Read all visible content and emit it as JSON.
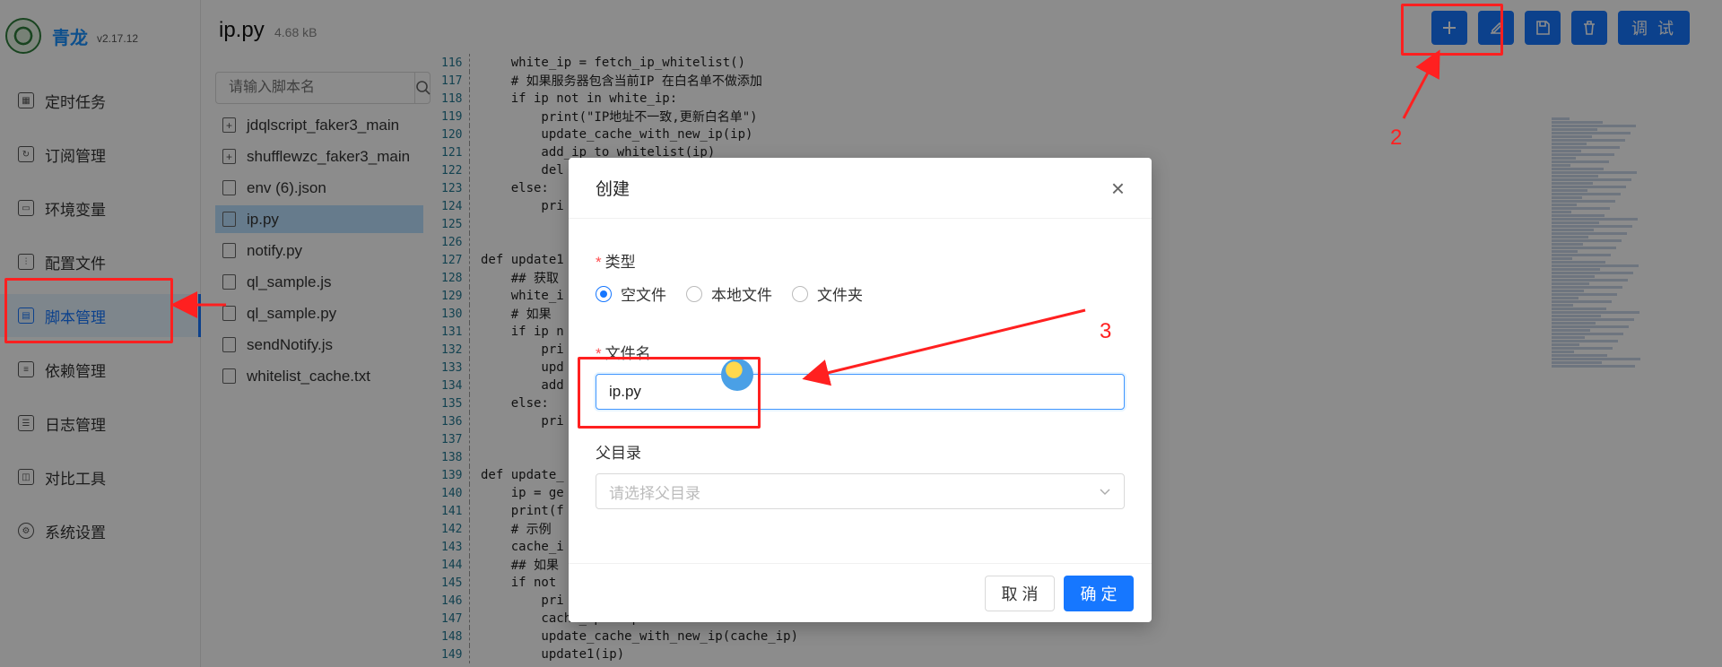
{
  "app": {
    "name": "青龙",
    "version": "v2.17.12"
  },
  "sidebar": {
    "items": [
      {
        "label": "定时任务",
        "icon": "calendar-icon"
      },
      {
        "label": "订阅管理",
        "icon": "subscribe-icon"
      },
      {
        "label": "环境变量",
        "icon": "monitor-icon"
      },
      {
        "label": "配置文件",
        "icon": "sliders-icon"
      },
      {
        "label": "脚本管理",
        "icon": "script-icon",
        "active": true
      },
      {
        "label": "依赖管理",
        "icon": "dependency-icon"
      },
      {
        "label": "日志管理",
        "icon": "log-icon"
      },
      {
        "label": "对比工具",
        "icon": "diff-icon"
      },
      {
        "label": "系统设置",
        "icon": "gear-icon"
      }
    ]
  },
  "header": {
    "file_name": "ip.py",
    "file_size": "4.68 kB",
    "debug_label": "调 试"
  },
  "file_panel": {
    "search_placeholder": "请输入脚本名",
    "files": [
      {
        "name": "jdqlscript_faker3_main",
        "type": "folder"
      },
      {
        "name": "shufflewzc_faker3_main",
        "type": "folder"
      },
      {
        "name": "env (6).json",
        "type": "file"
      },
      {
        "name": "ip.py",
        "type": "file",
        "selected": true
      },
      {
        "name": "notify.py",
        "type": "file"
      },
      {
        "name": "ql_sample.js",
        "type": "file"
      },
      {
        "name": "ql_sample.py",
        "type": "file"
      },
      {
        "name": "sendNotify.js",
        "type": "file"
      },
      {
        "name": "whitelist_cache.txt",
        "type": "file"
      }
    ]
  },
  "editor": {
    "lines": [
      {
        "n": "116",
        "t": "    white_ip = fetch_ip_whitelist()"
      },
      {
        "n": "117",
        "t": "    # 如果服务器包含当前IP 在白名单不做添加"
      },
      {
        "n": "118",
        "t": "    if ip not in white_ip:"
      },
      {
        "n": "119",
        "t": "        print(\"IP地址不一致,更新白名单\")"
      },
      {
        "n": "120",
        "t": "        update_cache_with_new_ip(ip)"
      },
      {
        "n": "121",
        "t": "        add_ip_to_whitelist(ip)"
      },
      {
        "n": "122",
        "t": "        del"
      },
      {
        "n": "123",
        "t": "    else:"
      },
      {
        "n": "124",
        "t": "        pri"
      },
      {
        "n": "125",
        "t": ""
      },
      {
        "n": "126",
        "t": ""
      },
      {
        "n": "127",
        "t": "def update1"
      },
      {
        "n": "128",
        "t": "    ## 获取"
      },
      {
        "n": "129",
        "t": "    white_i"
      },
      {
        "n": "130",
        "t": "    # 如果"
      },
      {
        "n": "131",
        "t": "    if ip n"
      },
      {
        "n": "132",
        "t": "        pri"
      },
      {
        "n": "133",
        "t": "        upd"
      },
      {
        "n": "134",
        "t": "        add"
      },
      {
        "n": "135",
        "t": "    else:"
      },
      {
        "n": "136",
        "t": "        pri"
      },
      {
        "n": "137",
        "t": ""
      },
      {
        "n": "138",
        "t": ""
      },
      {
        "n": "139",
        "t": "def update_"
      },
      {
        "n": "140",
        "t": "    ip = ge"
      },
      {
        "n": "141",
        "t": "    print(f"
      },
      {
        "n": "142",
        "t": "    # 示例"
      },
      {
        "n": "143",
        "t": "    cache_i"
      },
      {
        "n": "144",
        "t": "    ## 如果"
      },
      {
        "n": "145",
        "t": "    if not"
      },
      {
        "n": "146",
        "t": "        pri"
      },
      {
        "n": "147",
        "t": "        cache_ip = ip"
      },
      {
        "n": "148",
        "t": "        update_cache_with_new_ip(cache_ip)"
      },
      {
        "n": "149",
        "t": "        update1(ip)"
      }
    ]
  },
  "modal": {
    "title": "创建",
    "type_label": "类型",
    "type_options": [
      {
        "label": "空文件",
        "checked": true
      },
      {
        "label": "本地文件",
        "checked": false
      },
      {
        "label": "文件夹",
        "checked": false
      }
    ],
    "filename_label": "文件名",
    "filename_value": "ip.py",
    "parent_label": "父目录",
    "parent_placeholder": "请选择父目录",
    "cancel_label": "取 消",
    "ok_label": "确 定"
  },
  "annotations": {
    "step2": "2",
    "step3": "3",
    "color": "#ff2020"
  },
  "colors": {
    "primary": "#1677ff",
    "active_bg": "#e6f4ff",
    "selected_file_bg": "#bae0ff"
  }
}
